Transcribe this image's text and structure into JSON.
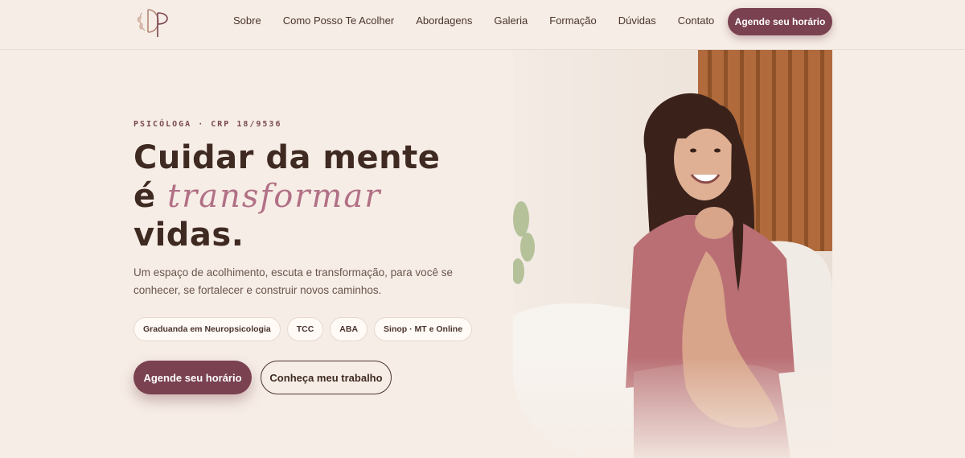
{
  "header": {
    "nav": [
      "Sobre",
      "Como Posso Te Acolher",
      "Abordagens",
      "Galeria",
      "Formação",
      "Dúvidas",
      "Contato"
    ],
    "cta_label": "Agende seu horário"
  },
  "hero": {
    "eyebrow": "PSICÓLOGA · CRP 18/9536",
    "headline_line1": "Cuidar da mente",
    "headline_prefix": "é",
    "headline_script": "transformar",
    "headline_line3": "vidas.",
    "subtitle": "Um espaço de acolhimento, escuta e transformação, para você se conhecer, se fortalecer e construir novos caminhos.",
    "chips": [
      "Graduanda em Neuropsicologia",
      "TCC",
      "ABA",
      "Sinop · MT e Online"
    ],
    "primary_button": "Agende seu horário",
    "secondary_button": "Conheça meu trabalho"
  },
  "colors": {
    "background": "#f6ede6",
    "accent": "#7a4150",
    "script_accent": "#b27086",
    "text": "#3f2a22"
  }
}
